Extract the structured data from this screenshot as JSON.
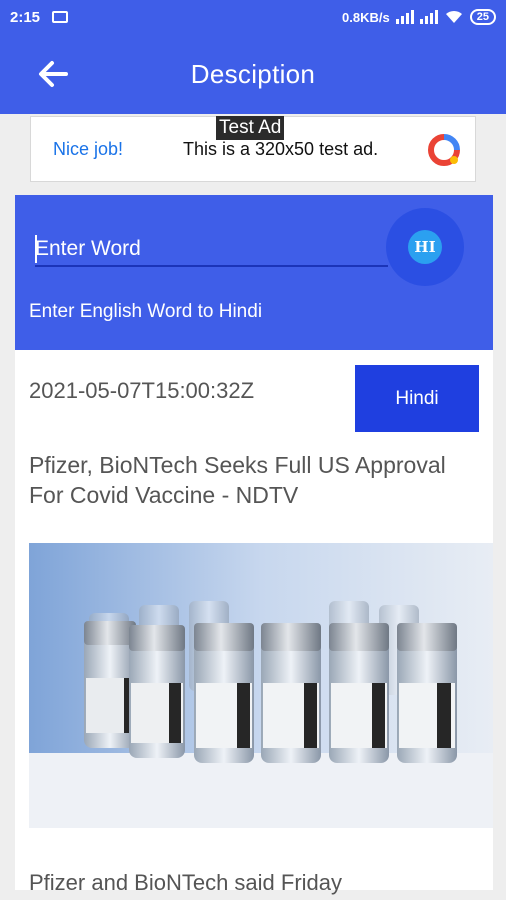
{
  "status_bar": {
    "time": "2:15",
    "speed": "0.8KB/s",
    "battery": "25"
  },
  "app_bar": {
    "title": "Desciption",
    "back_icon": "arrow-left-icon"
  },
  "ad": {
    "tag": "Test Ad",
    "left_text": "Nice job!",
    "right_text": "This is a 320x50 test ad."
  },
  "translator": {
    "placeholder": "Enter Word",
    "fab_label": "HI",
    "hint": "Enter English Word to Hindi"
  },
  "article": {
    "date": "2021-05-07T15:00:32Z",
    "hindi_button": "Hindi",
    "title": "Pfizer, BioNTech Seeks Full US Approval For Covid Vaccine - NDTV",
    "description": "Pfizer and BioNTech said Friday"
  },
  "colors": {
    "primary": "#3f5ee8",
    "button": "#1f3fe0",
    "fab_inner": "#2ba0f0"
  }
}
